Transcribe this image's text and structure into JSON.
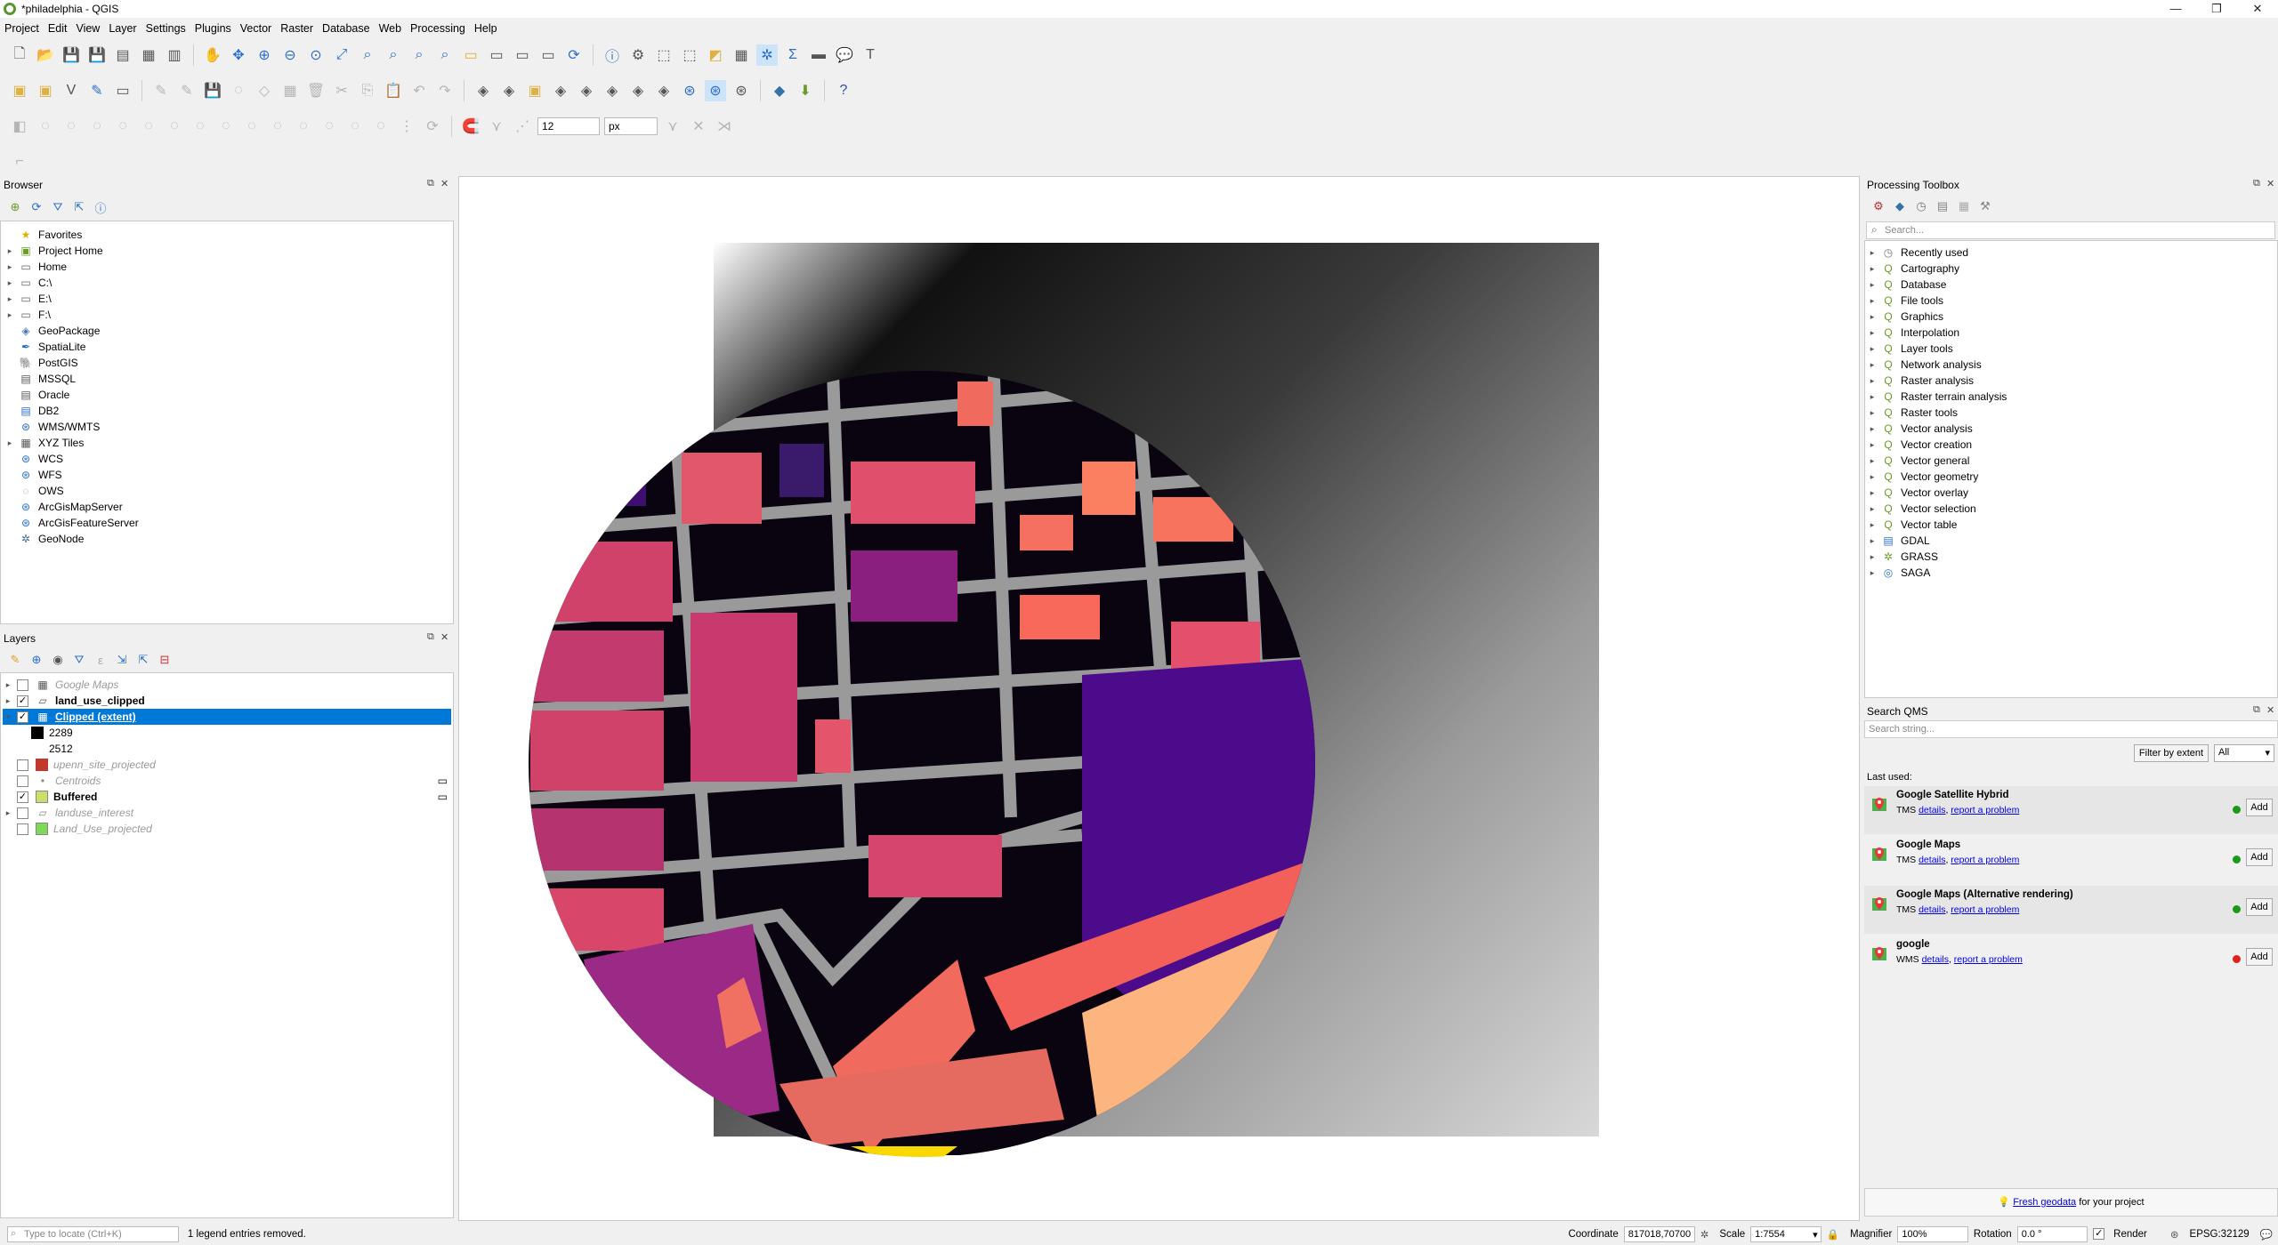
{
  "window": {
    "title": "*philadelphia - QGIS",
    "controls": [
      "—",
      "❐",
      "✕"
    ]
  },
  "menu": [
    "Project",
    "Edit",
    "View",
    "Layer",
    "Settings",
    "Plugins",
    "Vector",
    "Raster",
    "Database",
    "Web",
    "Processing",
    "Help"
  ],
  "toolbar": {
    "size_value": "12",
    "unit": "px"
  },
  "browser": {
    "title": "Browser",
    "items": [
      {
        "label": "Favorites",
        "icon": "star-icon",
        "expand": false
      },
      {
        "label": "Project Home",
        "icon": "project-home-icon",
        "expand": true
      },
      {
        "label": "Home",
        "icon": "folder-icon",
        "expand": true
      },
      {
        "label": "C:\\",
        "icon": "drive-icon",
        "expand": true
      },
      {
        "label": "E:\\",
        "icon": "drive-icon",
        "expand": true
      },
      {
        "label": "F:\\",
        "icon": "drive-icon",
        "expand": true
      },
      {
        "label": "GeoPackage",
        "icon": "geopackage-icon",
        "expand": false
      },
      {
        "label": "SpatiaLite",
        "icon": "spatialite-icon",
        "expand": false
      },
      {
        "label": "PostGIS",
        "icon": "postgis-icon",
        "expand": false
      },
      {
        "label": "MSSQL",
        "icon": "mssql-icon",
        "expand": false
      },
      {
        "label": "Oracle",
        "icon": "oracle-icon",
        "expand": false
      },
      {
        "label": "DB2",
        "icon": "db2-icon",
        "expand": false
      },
      {
        "label": "WMS/WMTS",
        "icon": "wms-icon",
        "expand": false
      },
      {
        "label": "XYZ Tiles",
        "icon": "xyz-icon",
        "expand": true
      },
      {
        "label": "WCS",
        "icon": "wcs-icon",
        "expand": false
      },
      {
        "label": "WFS",
        "icon": "wfs-icon",
        "expand": false
      },
      {
        "label": "OWS",
        "icon": "ows-icon",
        "expand": false
      },
      {
        "label": "ArcGisMapServer",
        "icon": "arcgis-icon",
        "expand": false
      },
      {
        "label": "ArcGisFeatureServer",
        "icon": "arcgis-icon",
        "expand": false
      },
      {
        "label": "GeoNode",
        "icon": "geonode-icon",
        "expand": false
      }
    ]
  },
  "layers": {
    "title": "Layers",
    "items": [
      {
        "label": "Google Maps",
        "checked": false,
        "style": "gray"
      },
      {
        "label": "land_use_clipped",
        "checked": true,
        "style": "bold"
      },
      {
        "label": "Clipped (extent)",
        "checked": true,
        "style": "selected"
      },
      {
        "label": "2289",
        "legend": true,
        "color": "#000000"
      },
      {
        "label": "2512",
        "legend": true,
        "color": "#ffffff"
      },
      {
        "label": "upenn_site_projected",
        "checked": false,
        "style": "gray",
        "color": "#c0392b"
      },
      {
        "label": "Centroids",
        "checked": false,
        "style": "gray"
      },
      {
        "label": "Buffered",
        "checked": true,
        "style": "bold",
        "color": "#c8e06a"
      },
      {
        "label": "landuse_interest",
        "checked": false,
        "style": "gray"
      },
      {
        "label": "Land_Use_projected",
        "checked": false,
        "style": "gray",
        "color": "#7ed957"
      }
    ]
  },
  "processing": {
    "title": "Processing Toolbox",
    "search_placeholder": "Search...",
    "items": [
      "Recently used",
      "Cartography",
      "Database",
      "File tools",
      "Graphics",
      "Interpolation",
      "Layer tools",
      "Network analysis",
      "Raster analysis",
      "Raster terrain analysis",
      "Raster tools",
      "Vector analysis",
      "Vector creation",
      "Vector general",
      "Vector geometry",
      "Vector overlay",
      "Vector selection",
      "Vector table",
      "GDAL",
      "GRASS",
      "SAGA"
    ]
  },
  "qms": {
    "title": "Search QMS",
    "search_placeholder": "Search string...",
    "filter_button": "Filter by extent",
    "filter_select": "All",
    "last_used": "Last used:",
    "add_label": "Add",
    "details": "details",
    "report": "report a problem",
    "items": [
      {
        "name": "Google Satellite Hybrid",
        "type": "TMS",
        "status": "#1a9a1a"
      },
      {
        "name": "Google Maps",
        "type": "TMS",
        "status": "#1a9a1a"
      },
      {
        "name": "Google Maps (Alternative rendering)",
        "type": "TMS",
        "status": "#1a9a1a"
      },
      {
        "name": "google",
        "type": "WMS",
        "status": "#e02020"
      }
    ],
    "footer_link": "Fresh geodata",
    "footer_text": "for your project"
  },
  "status": {
    "locate_placeholder": "Type to locate (Ctrl+K)",
    "message": "1 legend entries removed.",
    "coordinate_label": "Coordinate",
    "coordinate": "817018,70700",
    "scale_label": "Scale",
    "scale": "1:7554",
    "magnifier_label": "Magnifier",
    "magnifier": "100%",
    "rotation_label": "Rotation",
    "rotation": "0.0 °",
    "render_label": "Render",
    "crs": "EPSG:32129"
  }
}
